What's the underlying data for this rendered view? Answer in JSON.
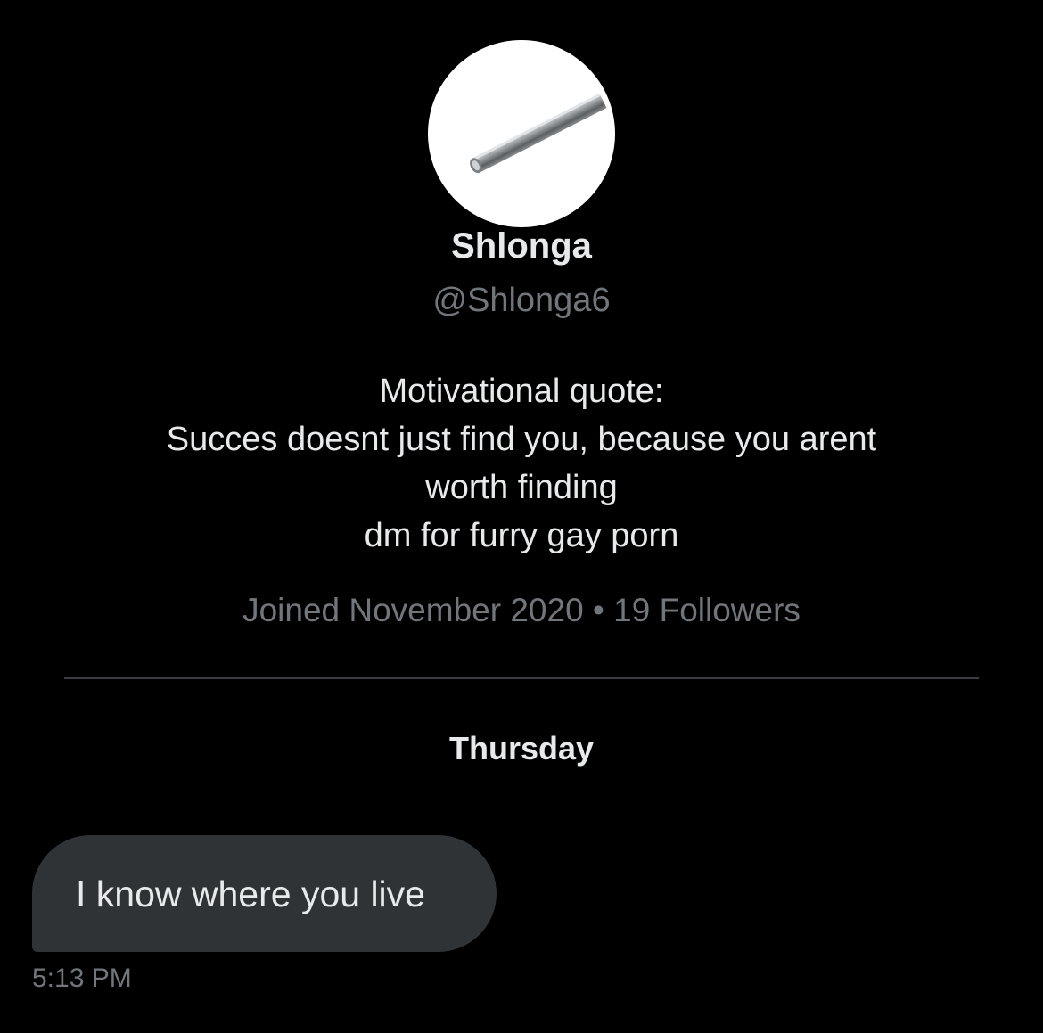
{
  "profile": {
    "display_name": "Shlonga",
    "handle": "@Shlonga6",
    "avatar_icon": "metal-pipe-avatar",
    "bio_lines": [
      "Motivational quote:",
      "Succes doesnt just find you, because you arent",
      "worth finding",
      "dm for furry gay porn"
    ],
    "meta": "Joined November 2020 • 19 Followers"
  },
  "conversation": {
    "day_label": "Thursday",
    "messages": [
      {
        "text": "I know where you live",
        "time": "5:13 PM"
      }
    ]
  },
  "colors": {
    "background": "#000000",
    "primary_text": "#e7e9ea",
    "secondary_text": "#71767b",
    "bubble": "#2f3336",
    "divider": "#3a3d41"
  }
}
